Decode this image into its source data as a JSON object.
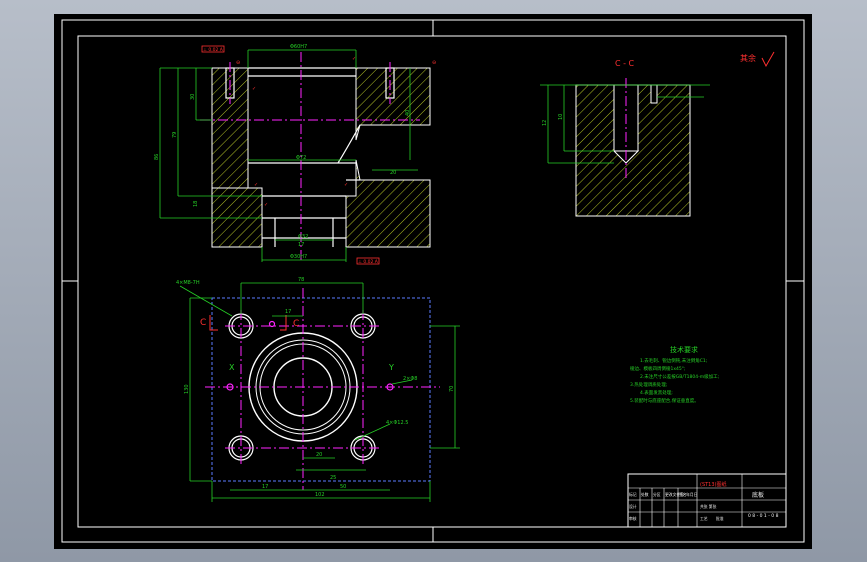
{
  "drawing": {
    "title_block": {
      "part_name": "底板",
      "drawing_number": "0 8 - 0 1 - 0 8",
      "school_mark": "(ST13)图纸",
      "table_labels": [
        "标记",
        "处数",
        "分区",
        "更改文件号",
        "签名",
        "年月日"
      ],
      "bottom_labels": [
        "设计",
        "审核",
        "工艺",
        "批准"
      ],
      "scale_label": "共张 第张"
    },
    "section_label": "C - C",
    "roughness_note": "其余",
    "datum_labels": {
      "x": "X",
      "y": "Y",
      "c1": "C",
      "c2": "C"
    },
    "tech_requirements": {
      "title": "技术要求",
      "lines": [
        "1.去毛刺、锐边倒钝,未注倒角C1;",
        "棱边、模板四周倒棱1x45°;",
        "2.未注尺寸公差按GB/T1804-m级加工;",
        "3.热处理调质处理;",
        "4.表面发黑处理;",
        "5.装配时与底座配合,保证垂直度。"
      ]
    },
    "dimensions": {
      "top_width": "Φ60H7",
      "depth_79": "79",
      "depth_86": "86",
      "d_30": "30",
      "d_18": "18",
      "d_40": "40",
      "d_72": "Φ72",
      "d_bottom": "Φ30H7",
      "d_32": "Φ32",
      "w_78": "78",
      "w_102": "102",
      "w_17": "17",
      "w_25": "25",
      "w_50": "50",
      "h_152": "152",
      "h_70": "70",
      "h_130": "130",
      "hole_callout_1": "4×M8-7H",
      "hole_callout_2": "2×Φ8",
      "hole_callout_3": "4×Φ12.5",
      "cc_10": "10",
      "cc_12": "12",
      "s_17": "17",
      "s_20": "20"
    },
    "gdt_top": "⊥ 0.02 A",
    "gdt_bottom": "⊥ 0.02 A",
    "roughness_values": [
      "3.2",
      "1.6",
      "3.2",
      "1.6",
      "3.2"
    ]
  },
  "colors": {
    "background": "#000000",
    "border": "#ffffff",
    "outline": "#ffffff",
    "hatch": "#c8d82a",
    "dimension": "#26d026",
    "centerline": "#ff24ff",
    "hidden": "#5b7dff",
    "annotation": "#ff3030",
    "text": "#f0f000"
  }
}
